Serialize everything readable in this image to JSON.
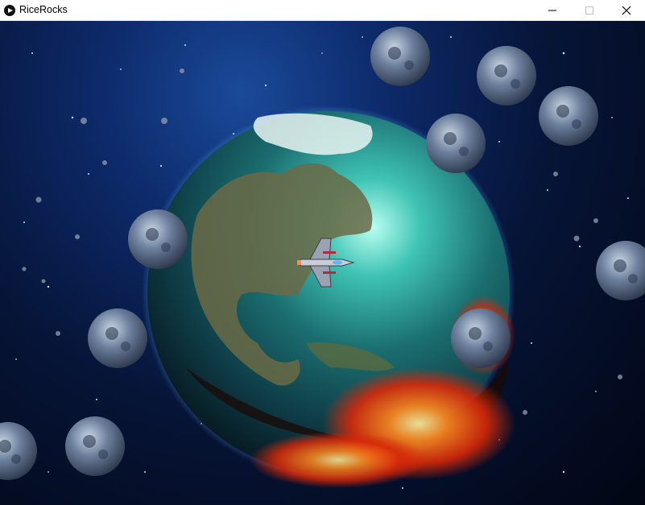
{
  "window": {
    "title": "RiceRocks"
  },
  "icons": {
    "app": "play-icon",
    "minimize": "minimize-icon",
    "maximize": "maximize-icon",
    "close": "close-icon"
  },
  "colors": {
    "space": "#061436",
    "ocean": "#1e7c7a",
    "land": "#6b6a45",
    "fire": "#ff4a10",
    "asteroid": "#5a6e8c"
  },
  "asteroid_count": 11
}
